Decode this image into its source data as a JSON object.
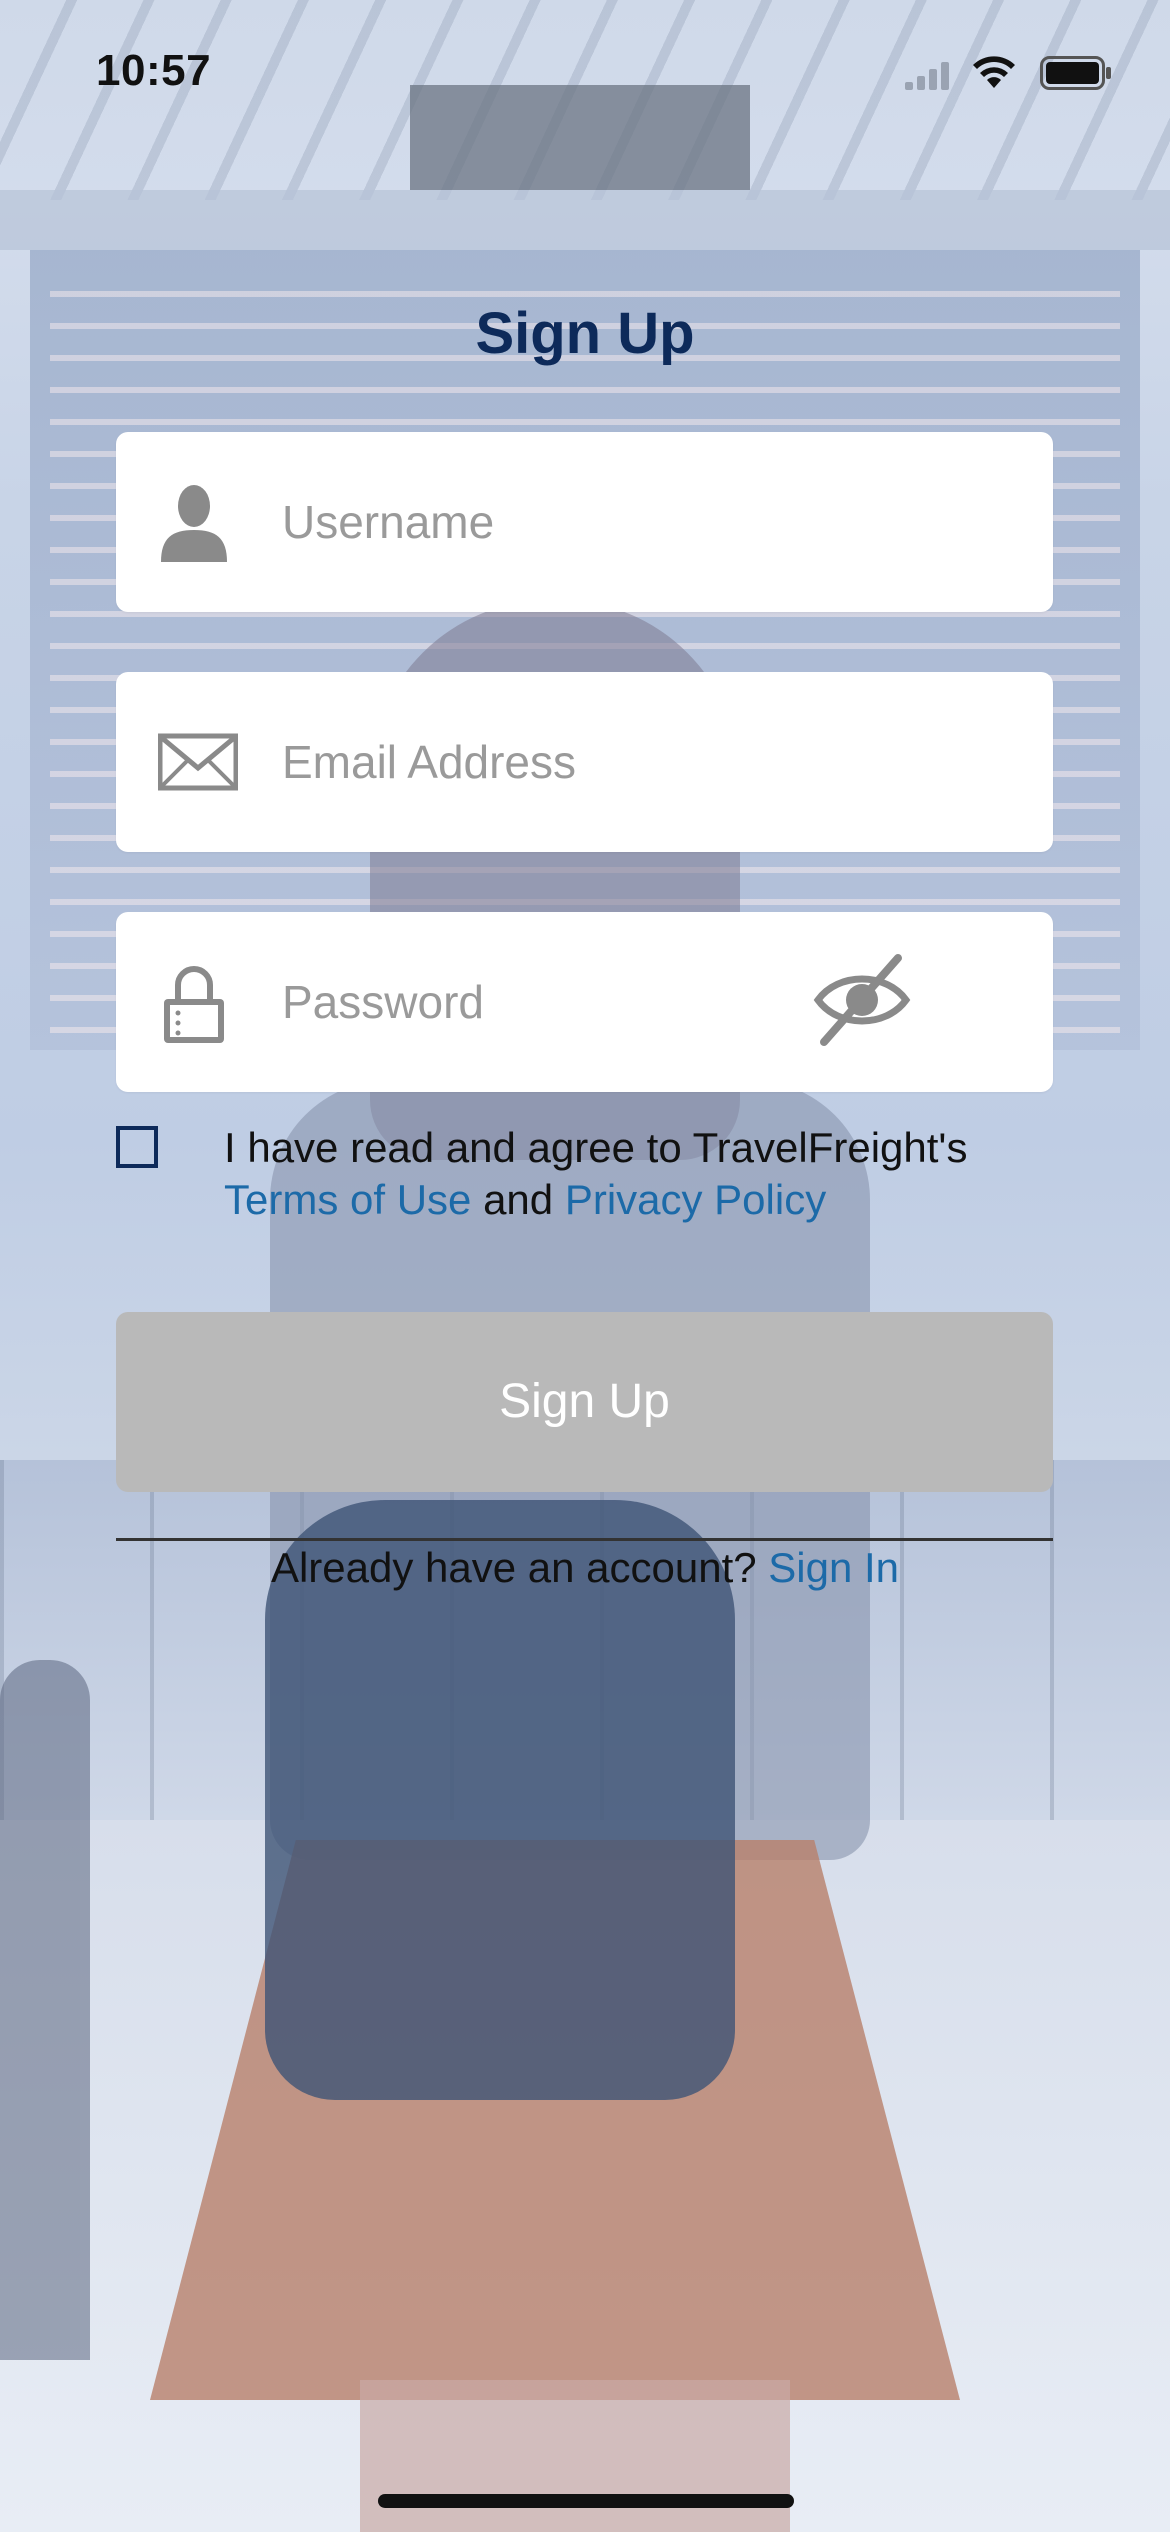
{
  "status_bar": {
    "time": "10:57"
  },
  "page": {
    "title": "Sign Up"
  },
  "form": {
    "username_placeholder": "Username",
    "email_placeholder": "Email Address",
    "password_placeholder": "Password",
    "agree_prefix": "I have read and agree to TravelFreight's",
    "terms_link": "Terms of Use",
    "and_word": "and",
    "privacy_link": "Privacy Policy",
    "agree_checked": false,
    "submit_label": "Sign Up"
  },
  "footer": {
    "have_account_text": "Already have an account?",
    "signin_link": "Sign In"
  },
  "colors": {
    "title": "#0d2a5a",
    "link": "#1c6aa8",
    "button_disabled": "#b9b9b9",
    "field_bg": "#ffffff",
    "placeholder": "#9a9a9a"
  },
  "icons": [
    "person-icon",
    "envelope-icon",
    "lock-icon",
    "eye-slash-icon",
    "cellular-signal-icon",
    "wifi-icon",
    "battery-icon"
  ]
}
